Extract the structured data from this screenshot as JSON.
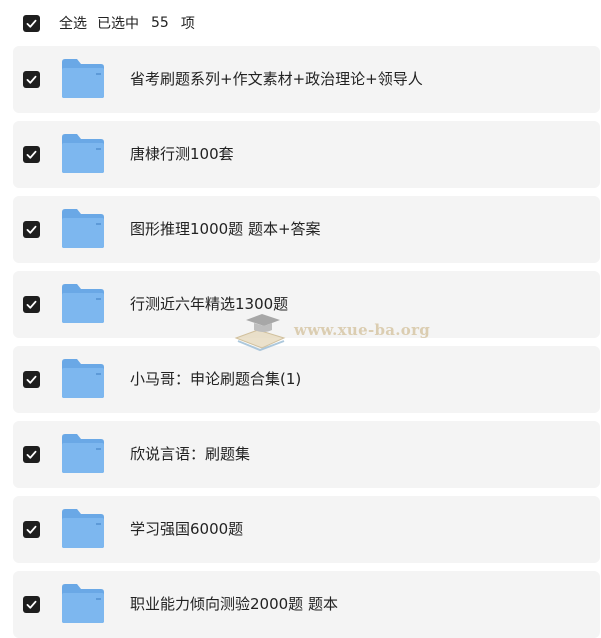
{
  "header": {
    "select_all_label": "全选",
    "selected_prefix": "已选中",
    "selected_count": "55",
    "selected_suffix": "项"
  },
  "items": [
    {
      "name": "省考刷题系列+作文素材+政治理论+领导人"
    },
    {
      "name": "唐棣行测100套"
    },
    {
      "name": "图形推理1000题 题本+答案"
    },
    {
      "name": "行测近六年精选1300题"
    },
    {
      "name": "小马哥：申论刷题合集(1)"
    },
    {
      "name": "欣说言语：刷题集"
    },
    {
      "name": "学习强国6000题"
    },
    {
      "name": "职业能力倾向测验2000题 题本"
    }
  ],
  "watermark": {
    "text": "www.xue-ba.org"
  },
  "colors": {
    "folder": "#7db7ef",
    "folder_tab": "#6aa8e6",
    "row_bg": "#f4f4f4",
    "checkbox": "#1e1e1e"
  }
}
